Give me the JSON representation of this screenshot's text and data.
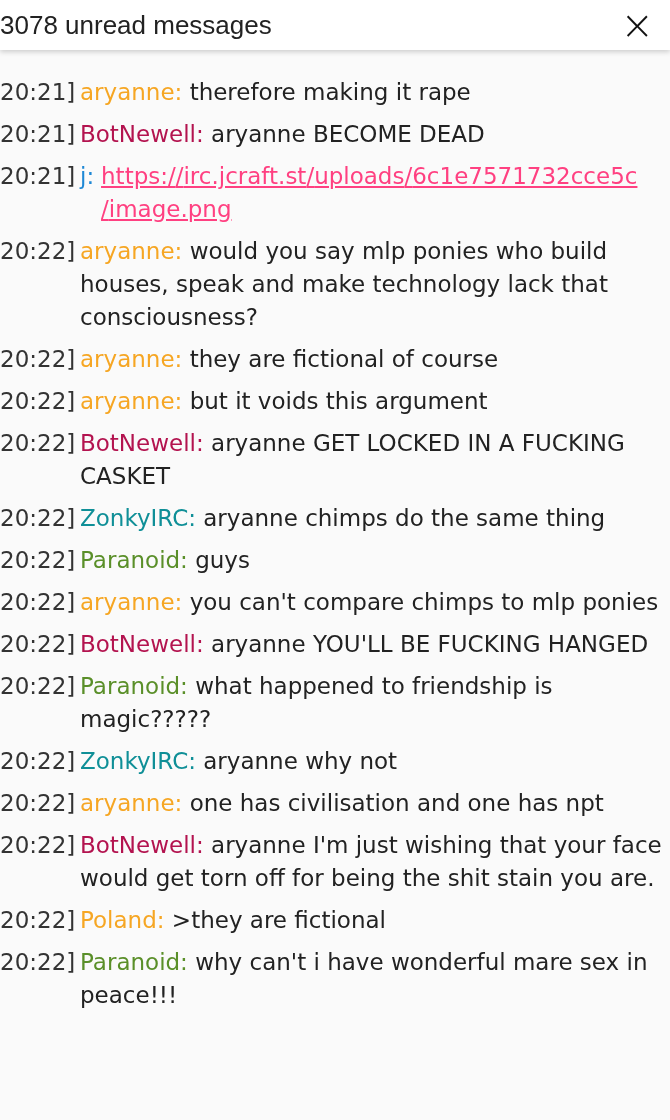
{
  "header": {
    "title": "3078 unread messages",
    "close": "×"
  },
  "messages": [
    {
      "time": "20:21]",
      "nick": "aryanne:",
      "color": "#f6a623",
      "kind": "text",
      "text": "therefore making it rape"
    },
    {
      "time": "20:21]",
      "nick": "BotNewell:",
      "color": "#b3134f",
      "kind": "text",
      "text": "aryanne BECOME DEAD"
    },
    {
      "time": "20:21]",
      "nick": "j:",
      "color": "#1e88d5",
      "kind": "link",
      "text": "https://irc.jcraft.st/uploads/6c1e7571732cce5c/image.png"
    },
    {
      "time": "20:22]",
      "nick": "aryanne:",
      "color": "#f6a623",
      "kind": "text",
      "text": "would you say mlp ponies who build houses, speak and make technology lack that consciousness?"
    },
    {
      "time": "20:22]",
      "nick": "aryanne:",
      "color": "#f6a623",
      "kind": "text",
      "text": "they are fictional of course"
    },
    {
      "time": "20:22]",
      "nick": "aryanne:",
      "color": "#f6a623",
      "kind": "text",
      "text": "but it voids this argument"
    },
    {
      "time": "20:22]",
      "nick": "BotNewell:",
      "color": "#b3134f",
      "kind": "text",
      "text": "aryanne GET LOCKED IN A FUCKING CASKET"
    },
    {
      "time": "20:22]",
      "nick": "ZonkyIRC:",
      "color": "#0f8f97",
      "kind": "text",
      "text": "aryanne chimps do the same thing"
    },
    {
      "time": "20:22]",
      "nick": "Paranoid:",
      "color": "#5a8f29",
      "kind": "text",
      "text": "guys"
    },
    {
      "time": "20:22]",
      "nick": "aryanne:",
      "color": "#f6a623",
      "kind": "text",
      "text": "you can't compare chimps to mlp ponies"
    },
    {
      "time": "20:22]",
      "nick": "BotNewell:",
      "color": "#b3134f",
      "kind": "text",
      "text": "aryanne YOU'LL BE FUCKING HANGED"
    },
    {
      "time": "20:22]",
      "nick": "Paranoid:",
      "color": "#5a8f29",
      "kind": "text",
      "text": "what happened to friendship is magic?????"
    },
    {
      "time": "20:22]",
      "nick": "ZonkyIRC:",
      "color": "#0f8f97",
      "kind": "text",
      "text": "aryanne why not"
    },
    {
      "time": "20:22]",
      "nick": "aryanne:",
      "color": "#f6a623",
      "kind": "text",
      "text": "one has civilisation and one has npt"
    },
    {
      "time": "20:22]",
      "nick": "BotNewell:",
      "color": "#b3134f",
      "kind": "text",
      "text": "aryanne I'm just wishing that your face would get torn off for being the shit stain you are."
    },
    {
      "time": "20:22]",
      "nick": "Poland:",
      "color": "#f6a623",
      "kind": "text",
      "text": ">they are fictional"
    },
    {
      "time": "20:22]",
      "nick": "Paranoid:",
      "color": "#5a8f29",
      "kind": "text",
      "text": "why can't i have wonderful mare sex in peace!!!"
    }
  ]
}
